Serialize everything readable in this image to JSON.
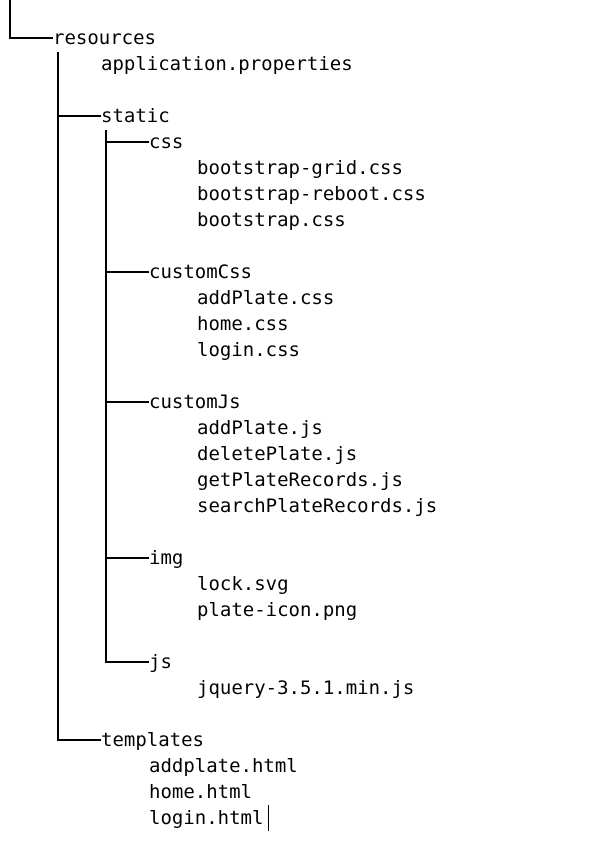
{
  "tree": {
    "resources": {
      "label": "resources",
      "files": [
        "application.properties"
      ]
    },
    "static": {
      "label": "static",
      "css": {
        "label": "css",
        "files": [
          "bootstrap-grid.css",
          "bootstrap-reboot.css",
          "bootstrap.css"
        ]
      },
      "customCss": {
        "label": "customCss",
        "files": [
          "addPlate.css",
          "home.css",
          "login.css"
        ]
      },
      "customJs": {
        "label": "customJs",
        "files": [
          "addPlate.js",
          "deletePlate.js",
          "getPlateRecords.js",
          "searchPlateRecords.js"
        ]
      },
      "img": {
        "label": "img",
        "files": [
          "lock.svg",
          "plate-icon.png"
        ]
      },
      "js": {
        "label": "js",
        "files": [
          "jquery-3.5.1.min.js"
        ]
      }
    },
    "templates": {
      "label": "templates",
      "files": [
        "addplate.html",
        "home.html",
        "login.html"
      ]
    }
  }
}
